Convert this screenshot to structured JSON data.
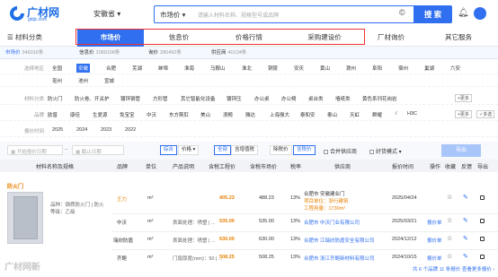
{
  "header": {
    "logo_text": "广材网",
    "logo_sub": "gldjc.com",
    "region": "安徽省 ▾",
    "search_category": "市场价 ▾",
    "search_placeholder": "请输入材料名称、规格型号或品牌",
    "search_button": "搜 索",
    "accent": "#2f6ff0"
  },
  "nav": {
    "materials_menu": "材料分类",
    "items": [
      "市场价",
      "信息价",
      "价格行情",
      "采购建设价",
      "厂材询价",
      "其它服务"
    ]
  },
  "subtabs": [
    {
      "label": "市场价",
      "count": "346016条"
    },
    {
      "label": "信息价",
      "count": "1089108条"
    },
    {
      "label": "询价",
      "count": "280492条"
    },
    {
      "label": "供应商",
      "count": "40134条"
    }
  ],
  "filters": {
    "region": {
      "label": "选择地区",
      "row1": [
        "全国",
        "安徽",
        "合肥",
        "芜湖",
        "蚌埠",
        "淮南",
        "马鞍山",
        "淮北",
        "铜陵",
        "安庆",
        "黄山",
        "滁州",
        "阜阳",
        "宿州",
        "巢湖",
        "六安"
      ],
      "row2": [
        "亳州",
        "池州",
        "宣城"
      ]
    },
    "category": {
      "label": "材料分类",
      "options": [
        "防火门",
        "防火卷、开关护",
        "镀锌钢管",
        "方形管",
        "其它智能化设备",
        "镀锌压",
        "办公桌",
        "办公椅",
        "桌台类",
        "墙纸类",
        "黄色系列花岗岩"
      ],
      "more": "+更多"
    },
    "brand": {
      "label": "品牌",
      "options": [
        "欧普",
        "康佳",
        "生爱源",
        "免宝宝",
        "中沃",
        "东方斯肛",
        "美山",
        "浪鲸",
        "雅达",
        "上海振大",
        "泰和安",
        "泰山",
        "天虹",
        "群耀",
        "/",
        "H3C"
      ],
      "more": "+更多",
      "multi": "✓多选"
    },
    "time": {
      "label": "报价时间",
      "options": [
        "2025",
        "2024",
        "2023",
        "2022"
      ]
    }
  },
  "toolbar": {
    "date_start": "开始报价日期",
    "date_end": "截止日期",
    "sort_combo": "综合",
    "sort_price": "价格 ▾",
    "tax_all": "全部",
    "tax_incl": "含增值税",
    "tax_low": "除税价",
    "tax_incl2": "含税价",
    "merge": "合并供应商",
    "mode": "好货模式 ▾",
    "export": "导出"
  },
  "table": {
    "headers": [
      "材料名称及规格",
      "品牌",
      "单位",
      "产品说明",
      "含税工程价",
      "含税市场价",
      "税率",
      "供应商",
      "报价时间",
      "操作",
      "收藏",
      "反馈",
      "导出"
    ],
    "category_title": "防火门",
    "product_desc": "品种：钢质防火门 | 防火等级：乙级",
    "rows": [
      {
        "brand": "王力",
        "unit": "m²",
        "desc": "",
        "eng_price": "405.23",
        "mkt_price": "488.23",
        "tax": "13%",
        "supplier": "合肥市 安徽建业门",
        "supplier_note1": "项目单位：浙行建筑",
        "supplier_note2": "工程用量：1730m²",
        "date": "2025/04/24",
        "op": ""
      },
      {
        "brand": "中沃",
        "unit": "m²",
        "desc": "表面处理：喷塑 | ...",
        "eng_price": "535.00",
        "mkt_price": "535.00",
        "tax": "13%",
        "supplier": "合肥市 中沃门业有限公司",
        "supplier_note1": "",
        "supplier_note2": "",
        "date": "2025/03/21",
        "op": "报价单"
      },
      {
        "brand": "瑞欣防盾",
        "unit": "m²",
        "desc": "表面处理：喷塑 | ...",
        "eng_price": "630.00",
        "mkt_price": "630.00",
        "tax": "13%",
        "supplier": "合肥市 江瑞欣防盾安全有限公司",
        "supplier_note1": "",
        "supplier_note2": "",
        "date": "2024/12/12",
        "op": "报价单"
      },
      {
        "brand": "齐鲍",
        "unit": "m²",
        "desc": "门扇厚度(mm)：50 | ...",
        "eng_price": "508.25",
        "mkt_price": "508.25",
        "tax": "13%",
        "supplier": "合肥市 浙江齐鲍新材料有限公司",
        "supplier_note1": "",
        "supplier_note2": "",
        "date": "2024/10/15",
        "op": "报价单"
      }
    ],
    "footer_note": "共 6 个品牌 11 条报价 查看更多报价 ›"
  },
  "watermark": "广材网新"
}
